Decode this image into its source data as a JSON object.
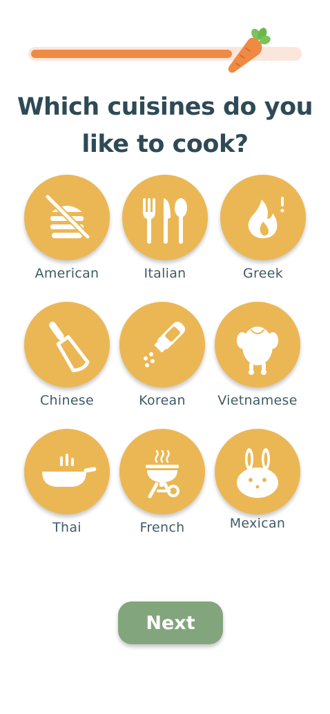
{
  "progress": {
    "value": 0.75
  },
  "header": {
    "title_line1": "Which cuisines do you",
    "title_line2": "like to cook?"
  },
  "cuisines": [
    {
      "label": "American",
      "icon": "burger-crossed-icon"
    },
    {
      "label": "Italian",
      "icon": "fork-knife-spoon-icon"
    },
    {
      "label": "Greek",
      "icon": "flame-icon"
    },
    {
      "label": "Chinese",
      "icon": "cleaver-knife-icon"
    },
    {
      "label": "Korean",
      "icon": "salt-shaker-icon"
    },
    {
      "label": "Vietnamese",
      "icon": "roast-chicken-icon"
    },
    {
      "label": "Thai",
      "icon": "frying-pan-icon"
    },
    {
      "label": "French",
      "icon": "grill-icon"
    },
    {
      "label": "Mexican",
      "icon": "rabbit-icon"
    }
  ],
  "footer": {
    "next_label": "Next"
  },
  "colors": {
    "accent": "#ebb755",
    "progress": "#ee8a43",
    "button": "#83a57d",
    "title": "#2e4a56"
  }
}
